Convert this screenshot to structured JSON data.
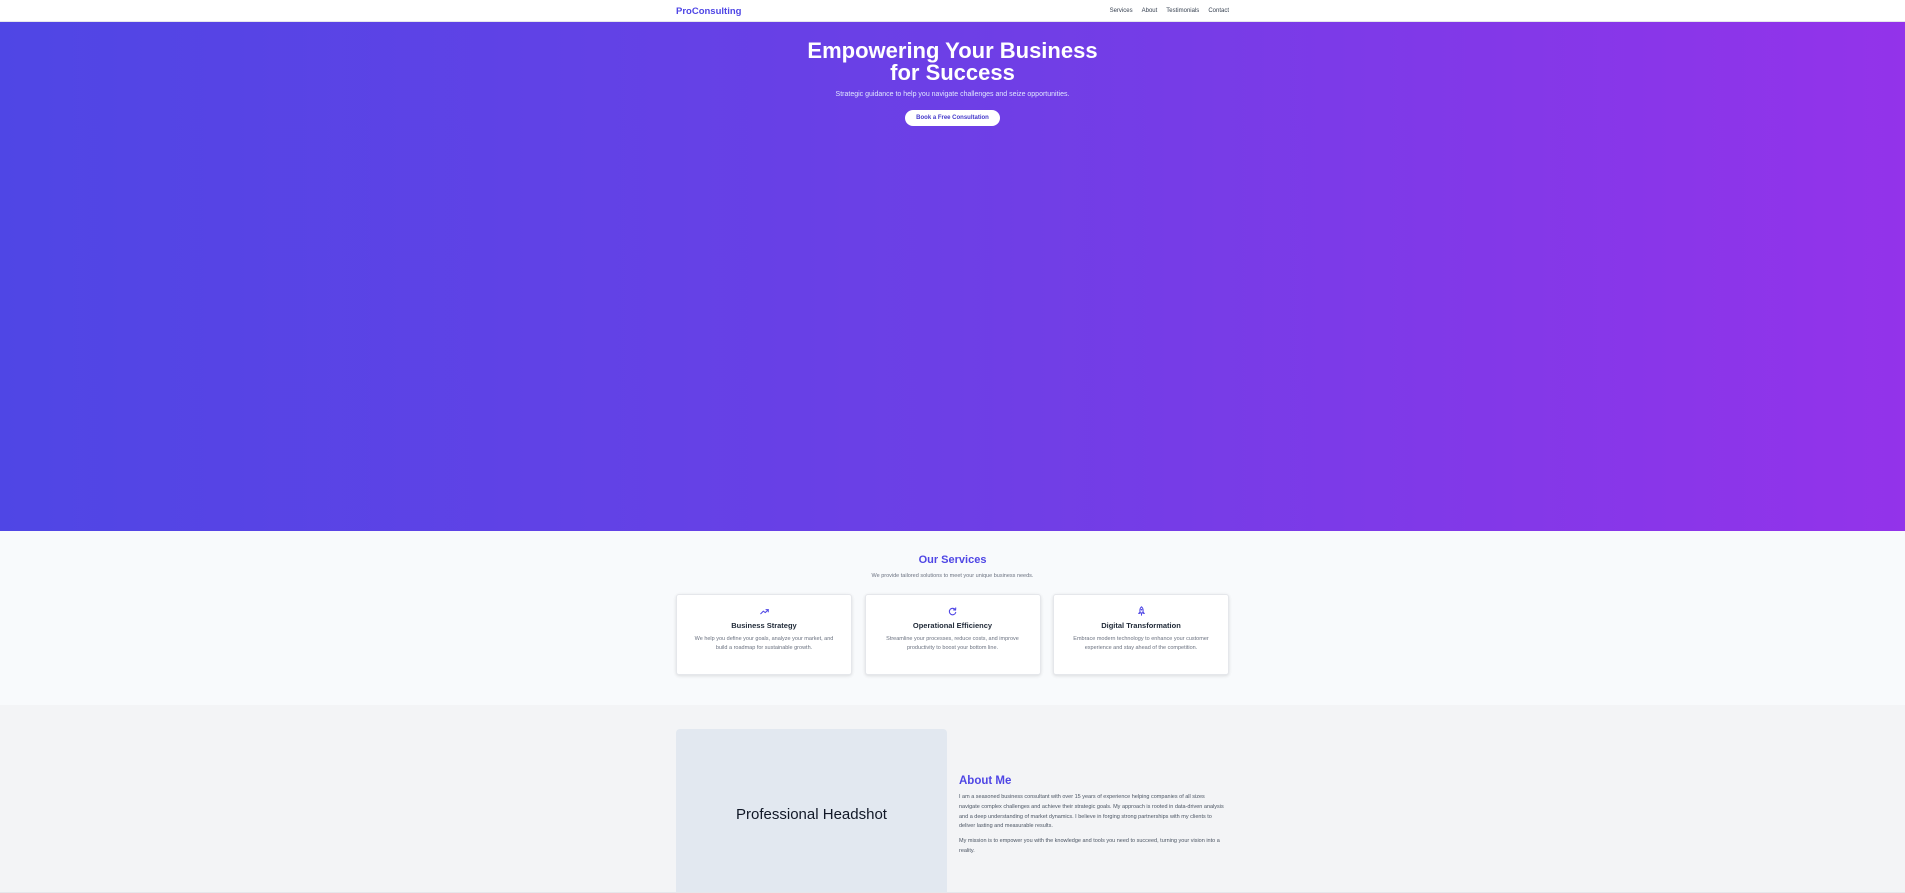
{
  "nav": {
    "brand": "ProConsulting",
    "links": [
      "Services",
      "About",
      "Testimonials",
      "Contact"
    ]
  },
  "hero": {
    "title": "Empowering Your Business for Success",
    "subtitle": "Strategic guidance to help you navigate challenges and seize opportunities.",
    "cta": "Book a Free Consultation"
  },
  "services": {
    "title": "Our Services",
    "subtitle": "We provide tailored solutions to meet your unique business needs.",
    "cards": [
      {
        "icon": "trending-up-icon",
        "title": "Business Strategy",
        "text": "We help you define your goals, analyze your market, and build a roadmap for sustainable growth."
      },
      {
        "icon": "refresh-icon",
        "title": "Operational Efficiency",
        "text": "Streamline your processes, reduce costs, and improve productivity to boost your bottom line."
      },
      {
        "icon": "rocket-icon",
        "title": "Digital Transformation",
        "text": "Embrace modern technology to enhance your customer experience and stay ahead of the competition."
      }
    ]
  },
  "about": {
    "headshot_label": "Professional Headshot",
    "title": "About Me",
    "paragraphs": [
      "I am a seasoned business consultant with over 15 years of experience helping companies of all sizes navigate complex challenges and achieve their strategic goals. My approach is rooted in data-driven analysis and a deep understanding of market dynamics. I believe in forging strong partnerships with my clients to deliver lasting and measurable results.",
      "My mission is to empower you with the knowledge and tools you need to succeed, turning your vision into a reality."
    ]
  },
  "colors": {
    "accent": "#4f46e5",
    "gradient_start": "#4f46e5",
    "gradient_end": "#9333ea"
  }
}
